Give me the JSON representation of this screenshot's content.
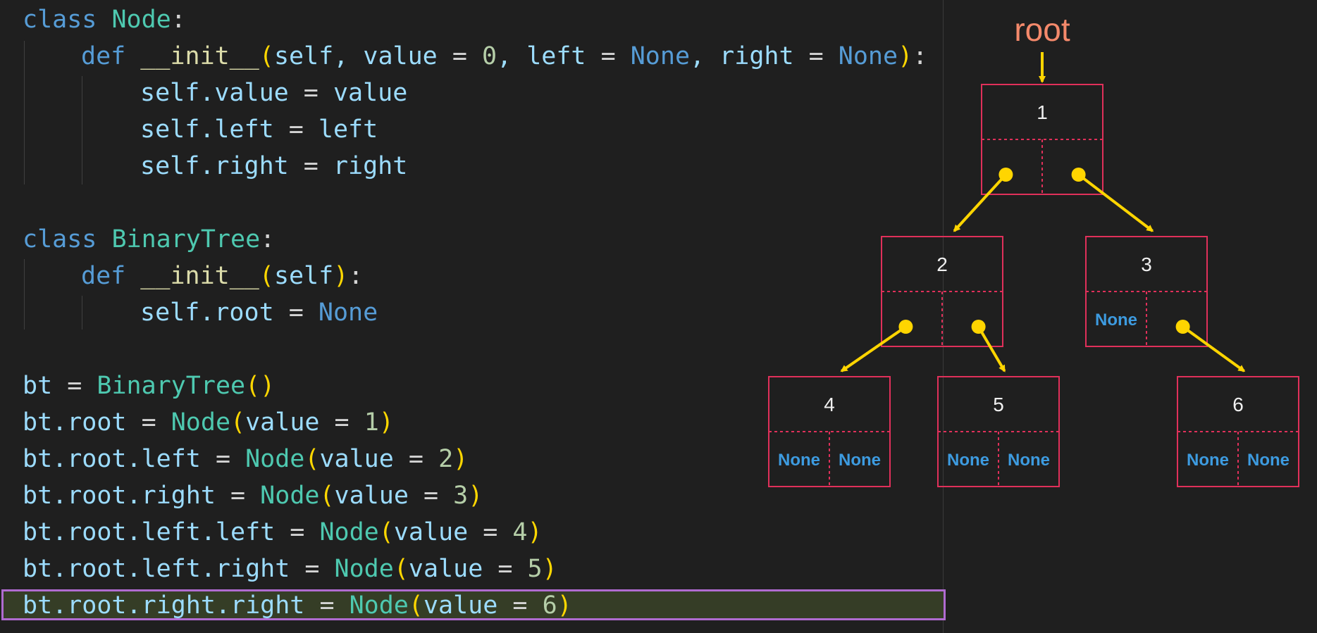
{
  "code": {
    "lines": [
      [
        "class ",
        "Node",
        ":"
      ],
      [
        "def ",
        "__init__",
        "(",
        "self, value ",
        "= ",
        "0",
        ", left ",
        "= ",
        "None",
        ", right ",
        "= ",
        "None",
        ")",
        ":"
      ],
      [
        "self.value ",
        "= ",
        "value"
      ],
      [
        "self.left ",
        "= ",
        "left"
      ],
      [
        "self.right ",
        "= ",
        "right"
      ],
      [
        "class ",
        "BinaryTree",
        ":"
      ],
      [
        "def ",
        "__init__",
        "(",
        "self",
        ")",
        ":"
      ],
      [
        "self.root ",
        "= ",
        "None"
      ],
      [
        "bt ",
        "= ",
        "BinaryTree",
        "(",
        ")"
      ],
      [
        "bt.root ",
        "= ",
        "Node",
        "(",
        "value ",
        "= ",
        "1",
        ")"
      ],
      [
        "bt.root.left ",
        "= ",
        "Node",
        "(",
        "value ",
        "= ",
        "2",
        ")"
      ],
      [
        "bt.root.right ",
        "= ",
        "Node",
        "(",
        "value ",
        "= ",
        "3",
        ")"
      ],
      [
        "bt.root.left.left ",
        "= ",
        "Node",
        "(",
        "value ",
        "= ",
        "4",
        ")"
      ],
      [
        "bt.root.left.right ",
        "= ",
        "Node",
        "(",
        "value ",
        "= ",
        "5",
        ")"
      ],
      [
        "bt.root.right.right ",
        "= ",
        "Node",
        "(",
        "value ",
        "= ",
        "6",
        ")"
      ]
    ]
  },
  "tree": {
    "root_label": "root",
    "null_label": "None",
    "nodes": [
      {
        "id": "n1",
        "value": "1",
        "left": "n2",
        "right": "n3"
      },
      {
        "id": "n2",
        "value": "2",
        "left": "n4",
        "right": "n5"
      },
      {
        "id": "n3",
        "value": "3",
        "left": null,
        "right": "n6"
      },
      {
        "id": "n4",
        "value": "4",
        "left": null,
        "right": null
      },
      {
        "id": "n5",
        "value": "5",
        "left": null,
        "right": null
      },
      {
        "id": "n6",
        "value": "6",
        "left": null,
        "right": null
      }
    ]
  },
  "colors": {
    "background": "#1f1f1f",
    "node_border": "#e0305a",
    "arrow": "#ffd500",
    "root_label": "#f4896b",
    "none_text": "#3d9be0",
    "node_value": "#f0f0f0",
    "highlight_bg": "#353d26",
    "highlight_border": "#b06bd0"
  }
}
